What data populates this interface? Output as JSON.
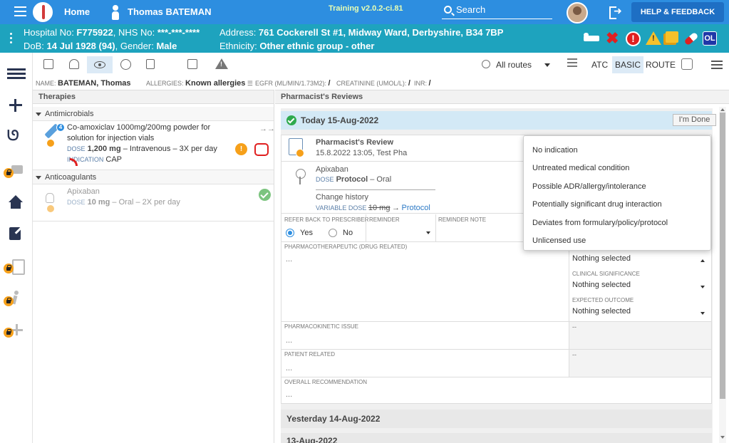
{
  "topbar": {
    "home": "Home",
    "patient_name": "Thomas BATEMAN",
    "version": "Training v2.0.2-ci.81",
    "search": "Search",
    "help": "HELP & FEEDBACK"
  },
  "banner": {
    "hospital_label": "Hospital No: ",
    "hospital_no": "F775922",
    "nhs_label": ", NHS No: ",
    "nhs_no": "***-***-****",
    "dob_label": "DoB: ",
    "dob": "14 Jul 1928 (94)",
    "gender_label": ", Gender: ",
    "gender": "Male",
    "address_label": "Address: ",
    "address": "761 Cockerell St #1, Midway Ward, Derbyshire, B34 7BP",
    "ethnicity_label": "Ethnicity: ",
    "ethnicity": "Other ethnic group - other",
    "ol_badge": "OL"
  },
  "toolbar": {
    "routes": "All routes",
    "atc": "ATC",
    "basic": "BASIC",
    "route": "ROUTE"
  },
  "infobar": {
    "name_label": "NAME:",
    "name": "BATEMAN, Thomas",
    "allergies_label": "ALLERGIES:",
    "allergies": "Known allergies",
    "egfr_label": "EGFR (ML/MIN/1.73M2):",
    "egfr": "/",
    "creat_label": "CREATININE (UMOL/L):",
    "creat": "/",
    "inr_label": "INR:",
    "inr": "/"
  },
  "therapies": {
    "title": "Therapies",
    "groups": [
      {
        "name": "Antimicrobials",
        "drug": {
          "name_line1": "Co-amoxiclav 1000mg/200mg powder for",
          "name_line2": "solution for injection vials",
          "badge": "4",
          "dose_label": "DOSE",
          "dose": "1,200 mg",
          "dose_rest": " – Intravenous – 3X per day",
          "indication_label": "INDICATION",
          "indication": "CAP"
        }
      },
      {
        "name": "Anticoagulants",
        "drug": {
          "name_line1": "Apixaban",
          "dose_label": "DOSE",
          "dose": "10 mg",
          "dose_rest": " – Oral – 2X per day"
        }
      }
    ]
  },
  "reviews": {
    "title": "Pharmacist's Reviews",
    "today": "Today 15-Aug-2022",
    "done_button": "I'm Done",
    "card_title": "Pharmacist's Review",
    "card_sub": "15.8.2022 13:05, Test Pha",
    "med_name": "Apixaban",
    "med_dose_label": "DOSE",
    "med_dose": "Protocol",
    "med_dose_rest": " – Oral",
    "change_history": "Change history",
    "variable_dose_label": "VARIABLE DOSE",
    "variable_dose_old": "10 mg",
    "variable_dose_new": "Protocol",
    "refer_label": "REFER BACK TO PRESCRIBER",
    "yes": "Yes",
    "no": "No",
    "reminder_label": "REMINDER",
    "reminder_note_label": "REMINDER NOTE",
    "pharmaco_label": "PHARMACOTHERAPEUTIC (DRUG RELATED)",
    "pharmaco_value": "...",
    "dd1": "Nothing selected",
    "clinical_label": "CLINICAL SIGNIFICANCE",
    "dd2": "Nothing selected",
    "expected_label": "EXPECTED OUTCOME",
    "dd3": "Nothing selected",
    "pk_label": "PHARMACOKINETIC ISSUE",
    "pk_value": "...",
    "pk_side": "--",
    "patient_label": "PATIENT RELATED",
    "patient_value": "...",
    "patient_side": "--",
    "overall_label": "OVERALL RECOMMENDATION",
    "overall_value": "...",
    "yesterday": "Yesterday 14-Aug-2022",
    "older": "13-Aug-2022"
  },
  "popup": {
    "options": [
      "No indication",
      "Untreated medical condition",
      "Possible ADR/allergy/intolerance",
      "Potentially significant drug interaction",
      "Deviates from formulary/policy/protocol",
      "Unlicensed use"
    ]
  },
  "colors": {
    "topbar": "#2d8ee0",
    "banner": "#1ea3be",
    "today_header": "#d3e9f6",
    "alert_red": "#e02020",
    "alert_amber": "#f6a01a"
  },
  "icons": [
    "menu-icon",
    "logo-icon",
    "person-icon",
    "search-icon",
    "logout-icon",
    "bed-icon",
    "x-icon",
    "exclamation-icon",
    "warning-icon",
    "copy-icon",
    "pill-icon",
    "list-icon",
    "plus-icon",
    "stethoscope-icon",
    "camera-icon",
    "house-icon",
    "edit-icon",
    "clipboard-icon",
    "walk-icon",
    "lock-icon",
    "eye-icon",
    "syringe-icon",
    "bell-icon",
    "check-icon"
  ]
}
